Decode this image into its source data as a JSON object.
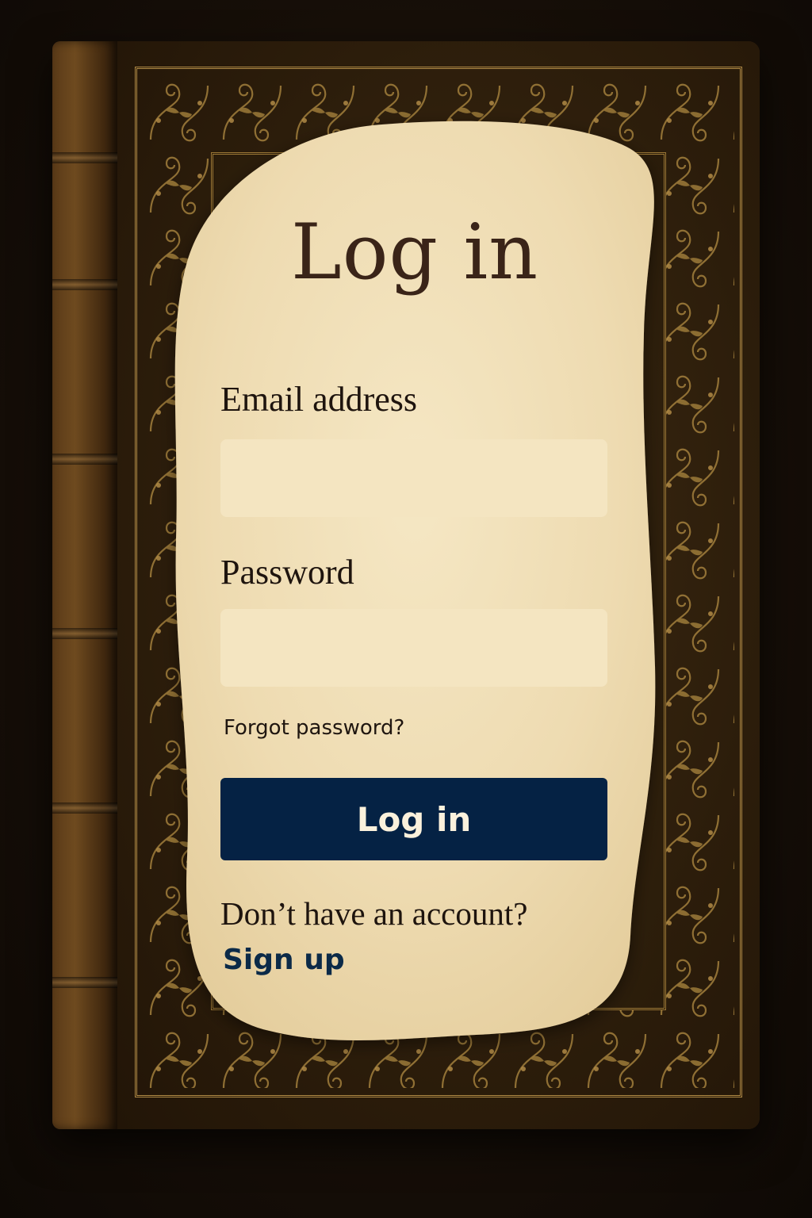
{
  "page": {
    "title": "Log in"
  },
  "form": {
    "email_label": "Email address",
    "email_value": "",
    "email_placeholder": "",
    "password_label": "Password",
    "password_value": "",
    "password_placeholder": "",
    "forgot_password": "Forgot password?",
    "submit_label": "Log in"
  },
  "footer": {
    "no_account_text": "Don’t have an account?",
    "signup_link": "Sign up"
  },
  "colors": {
    "parchment": "#f1e0b8",
    "input_fill": "#f4e5c1",
    "button": "#052244",
    "button_text": "#fbf1dc",
    "heading": "#3a2418",
    "link": "#0b2a48",
    "book_leather": "#3d2a12",
    "gold_ornament": "#b08a45"
  }
}
